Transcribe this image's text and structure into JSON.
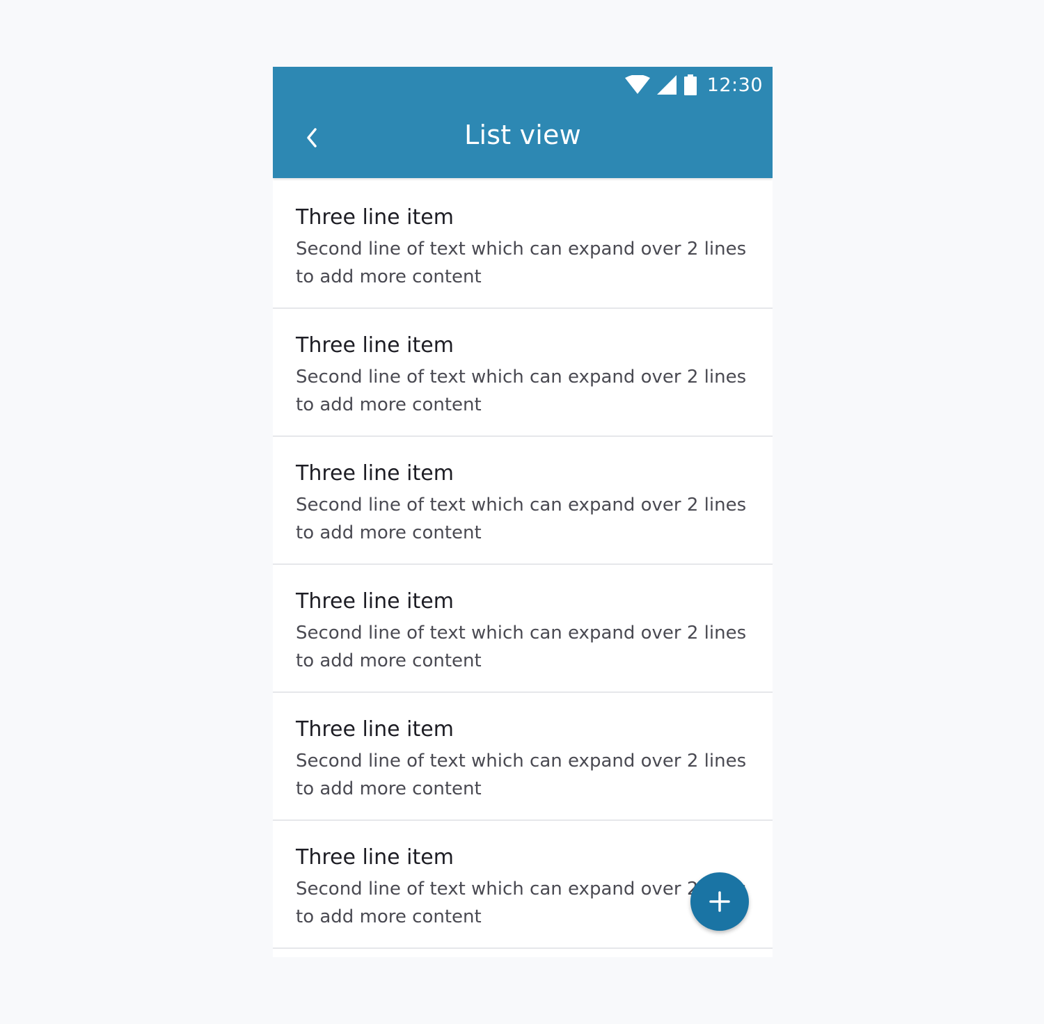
{
  "status_bar": {
    "time": "12:30",
    "icons": [
      "wifi-icon",
      "cellular-signal-icon",
      "battery-icon"
    ]
  },
  "app_bar": {
    "title": "List view",
    "back_icon": "chevron-left-icon"
  },
  "list": {
    "items": [
      {
        "title": "Three line item",
        "secondary": "Second line of text which can expand over 2 lines to add more content"
      },
      {
        "title": "Three line item",
        "secondary": "Second line of text which can expand over 2 lines to add more content"
      },
      {
        "title": "Three line item",
        "secondary": "Second line of text which can expand over 2 lines to add more content"
      },
      {
        "title": "Three line item",
        "secondary": "Second line of text which can expand over 2 lines to add more content"
      },
      {
        "title": "Three line item",
        "secondary": "Second line of text which can expand over 2 lines to add more content"
      },
      {
        "title": "Three line item",
        "secondary": "Second line of text which can expand over 2 lines to add more content"
      }
    ]
  },
  "fab": {
    "icon": "plus-icon"
  },
  "colors": {
    "primary": "#2d88b3",
    "fab": "#1a74a4",
    "background": "#f8f9fb",
    "divider": "#e6e7ea"
  }
}
